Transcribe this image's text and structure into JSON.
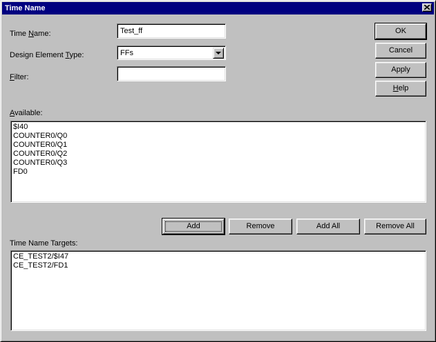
{
  "window": {
    "title": "Time Name"
  },
  "form": {
    "time_name": {
      "label_pre": "Time ",
      "label_accel": "N",
      "label_post": "ame:",
      "value": "Test_ff"
    },
    "design_element_type": {
      "label_pre": "Design Element ",
      "label_accel": "T",
      "label_post": "ype:",
      "value": "FFs"
    },
    "filter": {
      "label_pre": "",
      "label_accel": "F",
      "label_post": "ilter:",
      "value": ""
    }
  },
  "side_buttons": {
    "ok": "OK",
    "cancel": "Cancel",
    "apply": "Apply",
    "help_accel": "H",
    "help_post": "elp"
  },
  "available": {
    "label_accel": "A",
    "label_post": "vailable:",
    "items": [
      "$I40",
      "COUNTER0/Q0",
      "COUNTER0/Q1",
      "COUNTER0/Q2",
      "COUNTER0/Q3",
      "FD0"
    ]
  },
  "list_buttons": {
    "add": "Add",
    "remove": "Remove",
    "add_all": "Add All",
    "remove_all": "Remove All"
  },
  "targets": {
    "label": "Time Name Targets:",
    "items": [
      "CE_TEST2/$I47",
      "CE_TEST2/FD1"
    ]
  }
}
